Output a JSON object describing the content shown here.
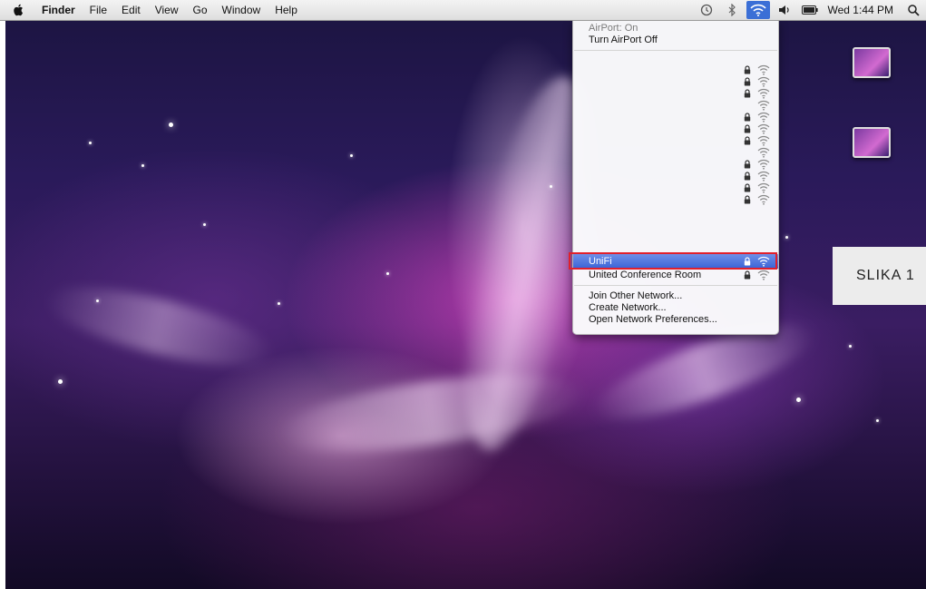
{
  "menubar": {
    "app_name": "Finder",
    "menus": [
      "File",
      "Edit",
      "View",
      "Go",
      "Window",
      "Help"
    ],
    "clock": "Wed 1:44 PM",
    "status_icons": [
      "time-machine-icon",
      "bluetooth-icon",
      "airport-wifi-icon",
      "volume-icon",
      "battery-icon",
      "spotlight-icon"
    ]
  },
  "airport_menu": {
    "status": "AirPort: On",
    "toggle_label": "Turn AirPort Off",
    "networks": [
      {
        "name": "",
        "locked": true
      },
      {
        "name": "",
        "locked": true
      },
      {
        "name": "",
        "locked": true
      },
      {
        "name": "",
        "locked": false
      },
      {
        "name": "",
        "locked": true
      },
      {
        "name": "",
        "locked": true
      },
      {
        "name": "",
        "locked": true
      },
      {
        "name": "",
        "locked": false
      },
      {
        "name": "",
        "locked": true
      },
      {
        "name": "",
        "locked": true
      },
      {
        "name": "",
        "locked": true
      },
      {
        "name": "",
        "locked": true
      },
      {
        "name": "UniFi",
        "locked": true,
        "selected": true
      },
      {
        "name": "United Conference Room",
        "locked": true
      }
    ],
    "actions": [
      "Join Other Network...",
      "Create Network...",
      "Open Network Preferences..."
    ]
  },
  "caption": "SLIKA 1",
  "colors": {
    "highlight": "#3a63d6",
    "annotation_border": "#e0202c"
  }
}
